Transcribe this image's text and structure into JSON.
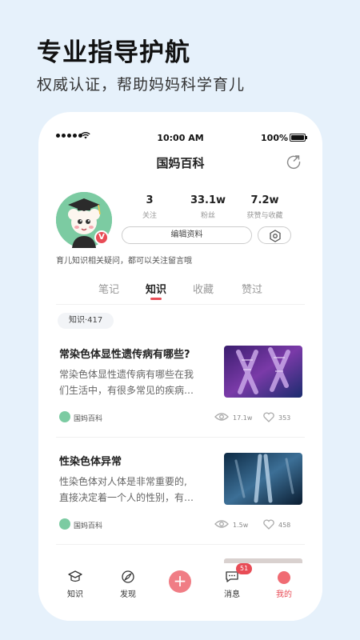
{
  "promo": {
    "title": "专业指导护航",
    "subtitle": "权威认证，帮助妈妈科学育儿"
  },
  "status_bar": {
    "time": "10:00 AM",
    "battery": "100%"
  },
  "header": {
    "title": "国妈百科",
    "share_icon": "share-icon"
  },
  "profile": {
    "stats": [
      {
        "value": "3",
        "label": "关注"
      },
      {
        "value": "33.1w",
        "label": "粉丝"
      },
      {
        "value": "7.2w",
        "label": "获赞与收藏"
      }
    ],
    "edit_label": "编辑资料",
    "verified_badge": "V",
    "bio": "育儿知识相关疑问，都可以关注留言哦"
  },
  "tabs": [
    {
      "label": "笔记",
      "active": false
    },
    {
      "label": "知识",
      "active": true
    },
    {
      "label": "收藏",
      "active": false
    },
    {
      "label": "赞过",
      "active": false
    }
  ],
  "filter_pill": "知识·417",
  "articles": [
    {
      "title": "常染色体显性遗传病有哪些?",
      "body_line1": "常染色体显性遗传病有哪些在我",
      "body_line2": "们生活中，有很多常见的疾病…",
      "author": "国妈百科",
      "views": "17.1w",
      "likes": "353"
    },
    {
      "title": "性染色体异常",
      "body_line1": "性染色体对人体是非常重要的,",
      "body_line2": "直接决定着一个人的性别，有…",
      "author": "国妈百科",
      "views": "1.5w",
      "likes": "458"
    }
  ],
  "bottom_nav": {
    "items": [
      {
        "label": "知识",
        "icon": "graduation-cap-icon"
      },
      {
        "label": "发现",
        "icon": "compass-icon"
      },
      {
        "label": "消息",
        "icon": "chat-bubble-icon",
        "badge": "51"
      },
      {
        "label": "我的",
        "icon": "me-icon",
        "active": true
      }
    ],
    "plus": "+"
  },
  "colors": {
    "accent": "#e84c56",
    "background": "#e6f1fb"
  }
}
